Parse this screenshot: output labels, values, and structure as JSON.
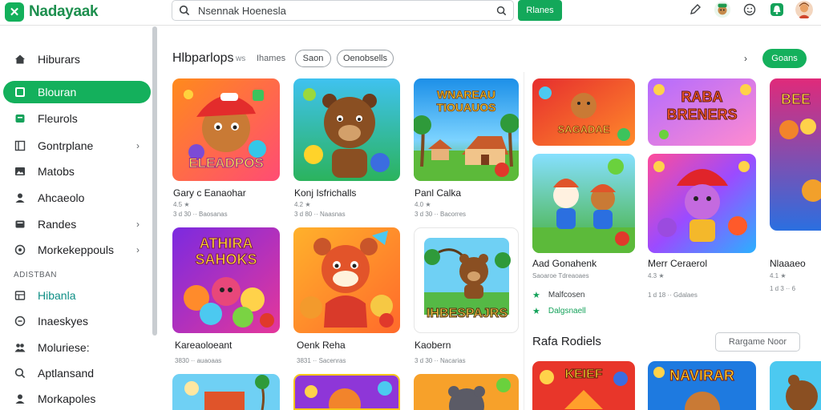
{
  "app": {
    "logo_text": "Nadayaak"
  },
  "search": {
    "value": "Nsennak Hoenesla",
    "button_label": "Rlanes"
  },
  "sidebar": {
    "items": [
      {
        "label": "Hiburars",
        "icon": "home-icon"
      },
      {
        "label": "Blouran",
        "icon": "grid-icon",
        "active": true
      },
      {
        "label": "Fleurols",
        "icon": "tag-icon"
      },
      {
        "label": "Gontrplane",
        "icon": "layout-icon",
        "chevron": true
      },
      {
        "label": "Matobs",
        "icon": "image-icon"
      },
      {
        "label": "Ahcaeolo",
        "icon": "user-icon"
      },
      {
        "label": "Randes",
        "icon": "box-icon",
        "chevron": true
      },
      {
        "label": "Morkekeppouls",
        "icon": "globe-icon",
        "chevron": true
      }
    ],
    "section_label": "ADISTBAN",
    "section_items": [
      {
        "label": "Hibanla",
        "icon": "table-icon",
        "teal": true
      },
      {
        "label": "Inaeskyes",
        "icon": "circle-icon"
      },
      {
        "label": "Moluriese:",
        "icon": "people-icon"
      },
      {
        "label": "Aptlansand",
        "icon": "search-icon"
      },
      {
        "label": "Morkapoles",
        "icon": "user-icon"
      }
    ]
  },
  "main": {
    "title": "Hlbparlops",
    "sub": "ws",
    "sub2": "Ihames",
    "chips": [
      "Saon",
      "Oenobsells"
    ],
    "button_label": "Goans"
  },
  "cards": [
    {
      "title": "Gary c Eanaohar",
      "meta": "3 d 30 ·· Baosanas"
    },
    {
      "title": "Konj Isfrichalls",
      "meta": "3 d 80 ·· Naasnas"
    },
    {
      "title": "Panl Calka",
      "meta": "3 d 30 ·· Bacorres"
    },
    {
      "title": "Kareaoloeant",
      "meta": "3830 ·· auaoaas"
    },
    {
      "title": "Oenk Reha",
      "meta": "3831 ·· Sacenras"
    },
    {
      "title": "Kaobern",
      "meta": "3 d 30 ·· Nacarias"
    }
  ],
  "card_texts": {
    "c1": "ELEADPOS",
    "c3": "WNAREAU TIOUAUOS",
    "c4": "ATHIRA SAHOKS",
    "c6": "IHBESPAJRS",
    "r1": "SAGADAE",
    "r2": "RABA BRENERS",
    "r3": "BEE",
    "r7": "NAVIRAR",
    "r8": "KEIEF"
  },
  "right": {
    "cards": [
      {
        "title": "Aad Gonahenk",
        "meta": "Saoaroe Tdreaoaes"
      },
      {
        "title": "Merr Ceraerol",
        "meta": "1 d 18 ·· Gdalaes"
      },
      {
        "title": "Nlaaaeo",
        "meta": "1 d 3 ·· 6"
      }
    ],
    "mini_rows": [
      "Malfcosen",
      "Dalgsnaell"
    ],
    "rate_title": "Rafa Rodiels",
    "rate_button": "Rargame Noor"
  },
  "colors": {
    "accent": "#14b05c",
    "brand": "#1d8f4e"
  }
}
